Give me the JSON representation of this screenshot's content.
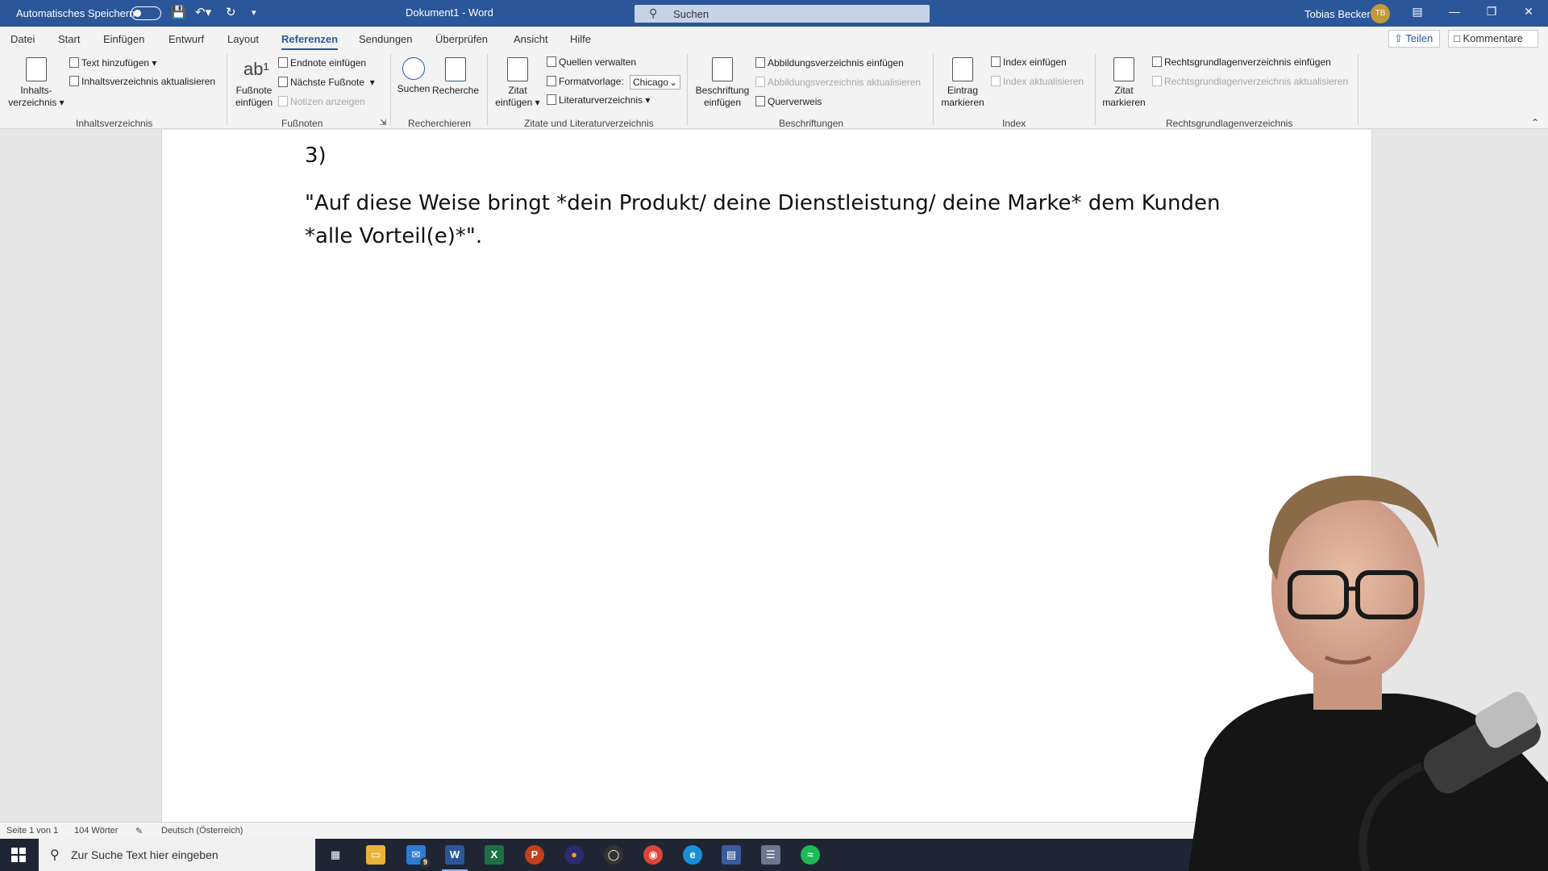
{
  "titlebar": {
    "autosave_label": "Automatisches Speichern",
    "doc_title": "Dokument1  -  Word",
    "search_placeholder": "Suchen",
    "user_name": "Tobias Becker",
    "user_initials": "TB"
  },
  "tabs": [
    "Datei",
    "Start",
    "Einfügen",
    "Entwurf",
    "Layout",
    "Referenzen",
    "Sendungen",
    "Überprüfen",
    "Ansicht",
    "Hilfe"
  ],
  "active_tab": "Referenzen",
  "share_label": "Teilen",
  "comments_label": "Kommentare",
  "ribbon": {
    "toc": {
      "big_label_1": "Inhalts-",
      "big_label_2": "verzeichnis",
      "add_text": "Text hinzufügen",
      "update_toc": "Inhaltsverzeichnis aktualisieren",
      "group": "Inhaltsverzeichnis"
    },
    "footnotes": {
      "insert_1": "Fußnote",
      "insert_2": "einfügen",
      "endnote": "Endnote einfügen",
      "next": "Nächste Fußnote",
      "show_notes": "Notizen anzeigen",
      "group": "Fußnoten"
    },
    "research": {
      "search": "Suchen",
      "researcher": "Recherche",
      "group": "Recherchieren"
    },
    "citations": {
      "insert_1": "Zitat",
      "insert_2": "einfügen",
      "manage": "Quellen verwalten",
      "style_label": "Formatvorlage:",
      "style_value": "Chicago",
      "bibliography": "Literaturverzeichnis",
      "group": "Zitate und Literaturverzeichnis"
    },
    "captions": {
      "insert_1": "Beschriftung",
      "insert_2": "einfügen",
      "table_of_figures": "Abbildungsverzeichnis einfügen",
      "update_tof": "Abbildungsverzeichnis aktualisieren",
      "cross_ref": "Querverweis",
      "group": "Beschriftungen"
    },
    "index": {
      "mark_1": "Eintrag",
      "mark_2": "markieren",
      "insert": "Index einfügen",
      "update": "Index aktualisieren",
      "group": "Index"
    },
    "authorities": {
      "mark_1": "Zitat",
      "mark_2": "markieren",
      "insert": "Rechtsgrundlagenverzeichnis einfügen",
      "update": "Rechtsgrundlagenverzeichnis aktualisieren",
      "group": "Rechtsgrundlagenverzeichnis"
    }
  },
  "document": {
    "line1": "3)",
    "line2": "\"Auf diese Weise bringt *dein Produkt/ deine Dienstleistung/ deine Marke* dem Kunden",
    "line3": "*alle Vorteil(e)*\"."
  },
  "status": {
    "page": "Seite 1 von 1",
    "words": "104 Wörter",
    "language": "Deutsch (Österreich)"
  },
  "taskbar": {
    "search_placeholder": "Zur Suche Text hier eingeben",
    "mail_badge": "9"
  }
}
